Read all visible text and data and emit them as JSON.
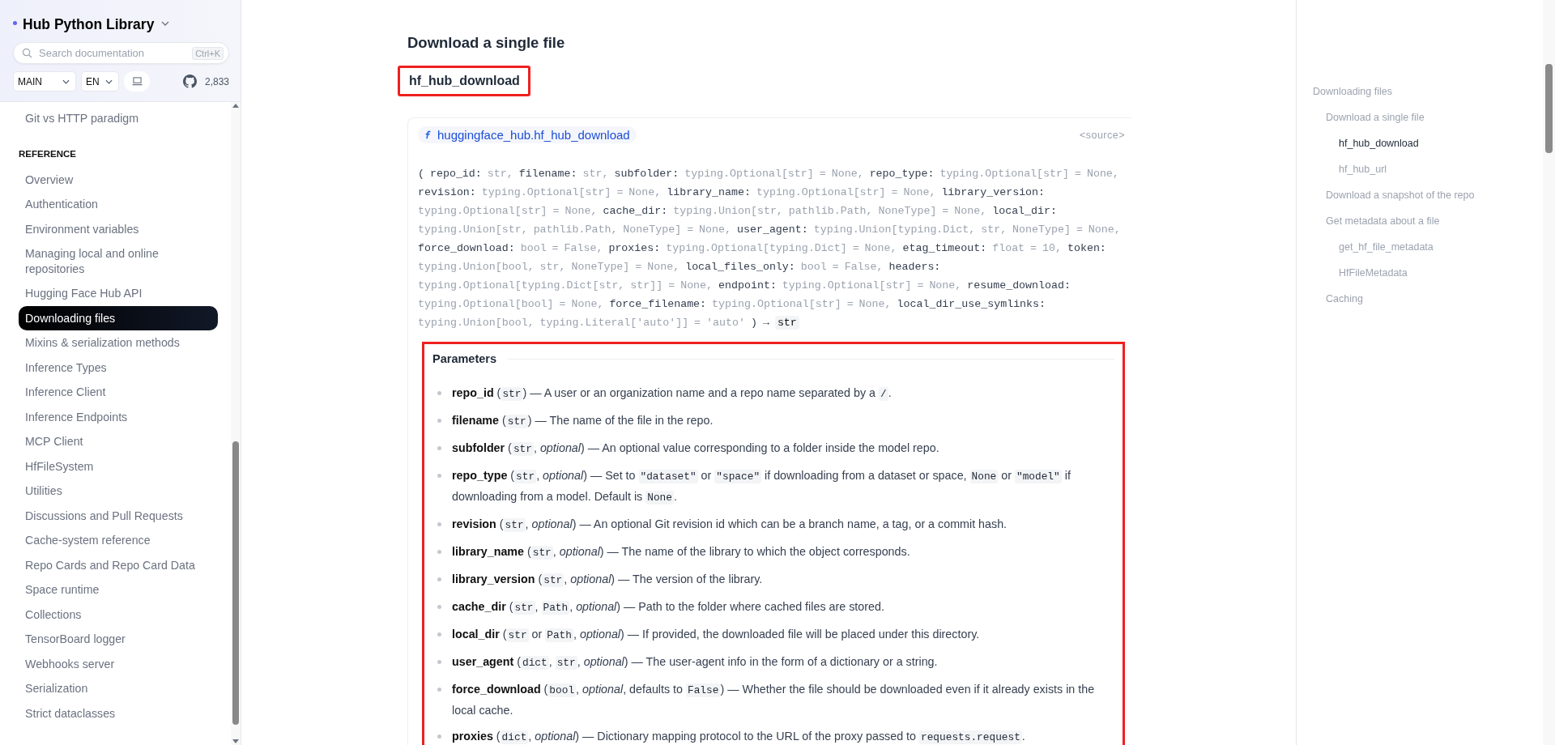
{
  "sidebar": {
    "title": "Hub Python Library",
    "search": {
      "placeholder": "Search documentation",
      "shortcut": "Ctrl+K"
    },
    "version": "MAIN",
    "language": "EN",
    "github_stars": "2,833",
    "top_items": [
      {
        "label": "Git vs HTTP paradigm",
        "selected": false
      }
    ],
    "sections": [
      {
        "heading": "REFERENCE",
        "items": [
          {
            "label": "Overview",
            "selected": false
          },
          {
            "label": "Authentication",
            "selected": false
          },
          {
            "label": "Environment variables",
            "selected": false
          },
          {
            "label": "Managing local and online repositories",
            "selected": false
          },
          {
            "label": "Hugging Face Hub API",
            "selected": false
          },
          {
            "label": "Downloading files",
            "selected": true
          },
          {
            "label": "Mixins & serialization methods",
            "selected": false
          },
          {
            "label": "Inference Types",
            "selected": false
          },
          {
            "label": "Inference Client",
            "selected": false
          },
          {
            "label": "Inference Endpoints",
            "selected": false
          },
          {
            "label": "MCP Client",
            "selected": false
          },
          {
            "label": "HfFileSystem",
            "selected": false
          },
          {
            "label": "Utilities",
            "selected": false
          },
          {
            "label": "Discussions and Pull Requests",
            "selected": false
          },
          {
            "label": "Cache-system reference",
            "selected": false
          },
          {
            "label": "Repo Cards and Repo Card Data",
            "selected": false
          },
          {
            "label": "Space runtime",
            "selected": false
          },
          {
            "label": "Collections",
            "selected": false
          },
          {
            "label": "TensorBoard logger",
            "selected": false
          },
          {
            "label": "Webhooks server",
            "selected": false
          },
          {
            "label": "Serialization",
            "selected": false
          },
          {
            "label": "Strict dataclasses",
            "selected": false
          }
        ]
      }
    ]
  },
  "main": {
    "section_title": "Download a single file",
    "heading": {
      "text": "hf_hub_download",
      "highlighted": true
    },
    "function": {
      "name": "huggingface_hub.hf_hub_download",
      "source": "<source>",
      "open_paren": "(",
      "close_paren": ")",
      "arrow": "→",
      "returns": "str",
      "params": [
        {
          "name": "repo_id:",
          "type": "str,"
        },
        {
          "name": "filename:",
          "type": "str,"
        },
        {
          "name": "subfolder:",
          "type": "typing.Optional[str] = None,"
        },
        {
          "name": "repo_type:",
          "type": "typing.Optional[str] = None,"
        },
        {
          "name": "revision:",
          "type": "typing.Optional[str] = None,"
        },
        {
          "name": "library_name:",
          "type": "typing.Optional[str] = None,"
        },
        {
          "name": "library_version:",
          "type": "typing.Optional[str] = None,"
        },
        {
          "name": "cache_dir:",
          "type": "typing.Union[str, pathlib.Path, NoneType] = None,"
        },
        {
          "name": "local_dir:",
          "type": "typing.Union[str, pathlib.Path, NoneType] = None,"
        },
        {
          "name": "user_agent:",
          "type": "typing.Union[typing.Dict, str, NoneType] = None,"
        },
        {
          "name": "force_download:",
          "type": "bool = False,"
        },
        {
          "name": "proxies:",
          "type": "typing.Optional[typing.Dict] = None,"
        },
        {
          "name": "etag_timeout:",
          "type": "float = 10,"
        },
        {
          "name": "token:",
          "type": "typing.Union[bool, str, NoneType] = None,"
        },
        {
          "name": "local_files_only:",
          "type": "bool = False,"
        },
        {
          "name": "headers:",
          "type": "typing.Optional[typing.Dict[str, str]] = None,"
        },
        {
          "name": "endpoint:",
          "type": "typing.Optional[str] = None,"
        },
        {
          "name": "resume_download:",
          "type": "typing.Optional[bool] = None,"
        },
        {
          "name": "force_filename:",
          "type": "typing.Optional[str] = None,"
        },
        {
          "name": "local_dir_use_symlinks:",
          "type": "typing.Union[bool, typing.Literal['auto']] = 'auto'"
        }
      ]
    },
    "parameters": {
      "title": "Parameters",
      "highlighted": true,
      "items": [
        {
          "segments": [
            {
              "kind": "name",
              "text": "repo_id"
            },
            {
              "kind": "text",
              "text": " ("
            },
            {
              "kind": "code",
              "text": "str"
            },
            {
              "kind": "text",
              "text": ") — A user or an organization name and a repo name separated by a "
            },
            {
              "kind": "code",
              "text": "/"
            },
            {
              "kind": "text",
              "text": "."
            }
          ]
        },
        {
          "segments": [
            {
              "kind": "name",
              "text": "filename"
            },
            {
              "kind": "text",
              "text": " ("
            },
            {
              "kind": "code",
              "text": "str"
            },
            {
              "kind": "text",
              "text": ") — The name of the file in the repo."
            }
          ]
        },
        {
          "segments": [
            {
              "kind": "name",
              "text": "subfolder"
            },
            {
              "kind": "text",
              "text": " ("
            },
            {
              "kind": "code",
              "text": "str"
            },
            {
              "kind": "text",
              "text": ", "
            },
            {
              "kind": "em",
              "text": "optional"
            },
            {
              "kind": "text",
              "text": ") — An optional value corresponding to a folder inside the model repo."
            }
          ]
        },
        {
          "segments": [
            {
              "kind": "name",
              "text": "repo_type"
            },
            {
              "kind": "text",
              "text": " ("
            },
            {
              "kind": "code",
              "text": "str"
            },
            {
              "kind": "text",
              "text": ", "
            },
            {
              "kind": "em",
              "text": "optional"
            },
            {
              "kind": "text",
              "text": ") — Set to "
            },
            {
              "kind": "code",
              "text": "\"dataset\""
            },
            {
              "kind": "text",
              "text": " or "
            },
            {
              "kind": "code",
              "text": "\"space\""
            },
            {
              "kind": "text",
              "text": " if downloading from a dataset or space, "
            },
            {
              "kind": "code",
              "text": "None"
            },
            {
              "kind": "text",
              "text": " or "
            },
            {
              "kind": "code",
              "text": "\"model\""
            },
            {
              "kind": "text",
              "text": " if downloading from a model. Default is "
            },
            {
              "kind": "code",
              "text": "None"
            },
            {
              "kind": "text",
              "text": "."
            }
          ]
        },
        {
          "segments": [
            {
              "kind": "name",
              "text": "revision"
            },
            {
              "kind": "text",
              "text": " ("
            },
            {
              "kind": "code",
              "text": "str"
            },
            {
              "kind": "text",
              "text": ", "
            },
            {
              "kind": "em",
              "text": "optional"
            },
            {
              "kind": "text",
              "text": ") — An optional Git revision id which can be a branch name, a tag, or a commit hash."
            }
          ]
        },
        {
          "segments": [
            {
              "kind": "name",
              "text": "library_name"
            },
            {
              "kind": "text",
              "text": " ("
            },
            {
              "kind": "code",
              "text": "str"
            },
            {
              "kind": "text",
              "text": ", "
            },
            {
              "kind": "em",
              "text": "optional"
            },
            {
              "kind": "text",
              "text": ") — The name of the library to which the object corresponds."
            }
          ]
        },
        {
          "segments": [
            {
              "kind": "name",
              "text": "library_version"
            },
            {
              "kind": "text",
              "text": " ("
            },
            {
              "kind": "code",
              "text": "str"
            },
            {
              "kind": "text",
              "text": ", "
            },
            {
              "kind": "em",
              "text": "optional"
            },
            {
              "kind": "text",
              "text": ") — The version of the library."
            }
          ]
        },
        {
          "segments": [
            {
              "kind": "name",
              "text": "cache_dir"
            },
            {
              "kind": "text",
              "text": " ("
            },
            {
              "kind": "code",
              "text": "str"
            },
            {
              "kind": "text",
              "text": ", "
            },
            {
              "kind": "code",
              "text": "Path"
            },
            {
              "kind": "text",
              "text": ", "
            },
            {
              "kind": "em",
              "text": "optional"
            },
            {
              "kind": "text",
              "text": ") — Path to the folder where cached files are stored."
            }
          ]
        },
        {
          "segments": [
            {
              "kind": "name",
              "text": "local_dir"
            },
            {
              "kind": "text",
              "text": " ("
            },
            {
              "kind": "code",
              "text": "str"
            },
            {
              "kind": "text",
              "text": " or "
            },
            {
              "kind": "code",
              "text": "Path"
            },
            {
              "kind": "text",
              "text": ", "
            },
            {
              "kind": "em",
              "text": "optional"
            },
            {
              "kind": "text",
              "text": ") — If provided, the downloaded file will be placed under this directory."
            }
          ]
        },
        {
          "segments": [
            {
              "kind": "name",
              "text": "user_agent"
            },
            {
              "kind": "text",
              "text": " ("
            },
            {
              "kind": "code",
              "text": "dict"
            },
            {
              "kind": "text",
              "text": ", "
            },
            {
              "kind": "code",
              "text": "str"
            },
            {
              "kind": "text",
              "text": ", "
            },
            {
              "kind": "em",
              "text": "optional"
            },
            {
              "kind": "text",
              "text": ") — The user-agent info in the form of a dictionary or a string."
            }
          ]
        },
        {
          "segments": [
            {
              "kind": "name",
              "text": "force_download"
            },
            {
              "kind": "text",
              "text": " ("
            },
            {
              "kind": "code",
              "text": "bool"
            },
            {
              "kind": "text",
              "text": ", "
            },
            {
              "kind": "em",
              "text": "optional"
            },
            {
              "kind": "text",
              "text": ", defaults to "
            },
            {
              "kind": "code",
              "text": "False"
            },
            {
              "kind": "text",
              "text": ") — Whether the file should be downloaded even if it already exists in the local cache."
            }
          ]
        },
        {
          "segments": [
            {
              "kind": "name",
              "text": "proxies"
            },
            {
              "kind": "text",
              "text": " ("
            },
            {
              "kind": "code",
              "text": "dict"
            },
            {
              "kind": "text",
              "text": ", "
            },
            {
              "kind": "em",
              "text": "optional"
            },
            {
              "kind": "text",
              "text": ") — Dictionary mapping protocol to the URL of the proxy passed to "
            },
            {
              "kind": "code",
              "text": "requests.request"
            },
            {
              "kind": "text",
              "text": "."
            }
          ]
        }
      ]
    }
  },
  "toc": {
    "items": [
      {
        "label": "Downloading files",
        "selected": false,
        "children": [
          {
            "label": "Download a single file",
            "selected": false,
            "children": [
              {
                "label": "hf_hub_download",
                "selected": true
              },
              {
                "label": "hf_hub_url",
                "selected": false
              }
            ]
          },
          {
            "label": "Download a snapshot of the repo",
            "selected": false
          },
          {
            "label": "Get metadata about a file",
            "selected": false,
            "children": [
              {
                "label": "get_hf_file_metadata",
                "selected": false
              },
              {
                "label": "HfFileMetadata",
                "selected": false
              }
            ]
          },
          {
            "label": "Caching",
            "selected": false
          }
        ]
      }
    ]
  }
}
